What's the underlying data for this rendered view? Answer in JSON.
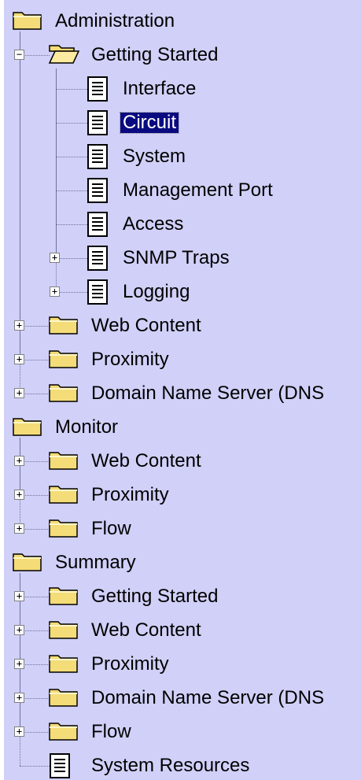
{
  "tree": [
    {
      "label": "Administration",
      "icon": "folder-icon",
      "level": 0,
      "toggle": null
    },
    {
      "label": "Getting Started",
      "icon": "folder-open-icon",
      "level": 1,
      "toggle": "minus"
    },
    {
      "label": "Interface",
      "icon": "document-icon",
      "level": 2,
      "toggle": null
    },
    {
      "label": "Circuit",
      "icon": "document-icon",
      "level": 2,
      "toggle": null,
      "selected": true
    },
    {
      "label": "System",
      "icon": "document-icon",
      "level": 2,
      "toggle": null
    },
    {
      "label": "Management Port",
      "icon": "document-icon",
      "level": 2,
      "toggle": null
    },
    {
      "label": "Access",
      "icon": "document-icon",
      "level": 2,
      "toggle": null
    },
    {
      "label": "SNMP Traps",
      "icon": "document-icon",
      "level": 2,
      "toggle": "plus"
    },
    {
      "label": "Logging",
      "icon": "document-icon",
      "level": 2,
      "toggle": "plus"
    },
    {
      "label": "Web Content",
      "icon": "folder-icon",
      "level": 1,
      "toggle": "plus"
    },
    {
      "label": "Proximity",
      "icon": "folder-icon",
      "level": 1,
      "toggle": "plus"
    },
    {
      "label": "Domain Name Server (DNS",
      "icon": "folder-icon",
      "level": 1,
      "toggle": "plus"
    },
    {
      "label": "Monitor",
      "icon": "folder-icon",
      "level": 0,
      "toggle": null
    },
    {
      "label": "Web Content",
      "icon": "folder-icon",
      "level": 1,
      "toggle": "plus"
    },
    {
      "label": "Proximity",
      "icon": "folder-icon",
      "level": 1,
      "toggle": "plus"
    },
    {
      "label": "Flow",
      "icon": "folder-icon",
      "level": 1,
      "toggle": "plus"
    },
    {
      "label": "Summary",
      "icon": "folder-icon",
      "level": 0,
      "toggle": null
    },
    {
      "label": "Getting Started",
      "icon": "folder-icon",
      "level": 1,
      "toggle": "plus"
    },
    {
      "label": "Web Content",
      "icon": "folder-icon",
      "level": 1,
      "toggle": "plus"
    },
    {
      "label": "Proximity",
      "icon": "folder-icon",
      "level": 1,
      "toggle": "plus"
    },
    {
      "label": "Domain Name Server (DNS",
      "icon": "folder-icon",
      "level": 1,
      "toggle": "plus"
    },
    {
      "label": "Flow",
      "icon": "folder-icon",
      "level": 1,
      "toggle": "plus"
    },
    {
      "label": "System Resources",
      "icon": "document-icon",
      "level": 1,
      "toggle": null
    }
  ],
  "colors": {
    "background": "#d0d0f8",
    "selection": "#0a0a80",
    "folder": "#f4dc78"
  }
}
